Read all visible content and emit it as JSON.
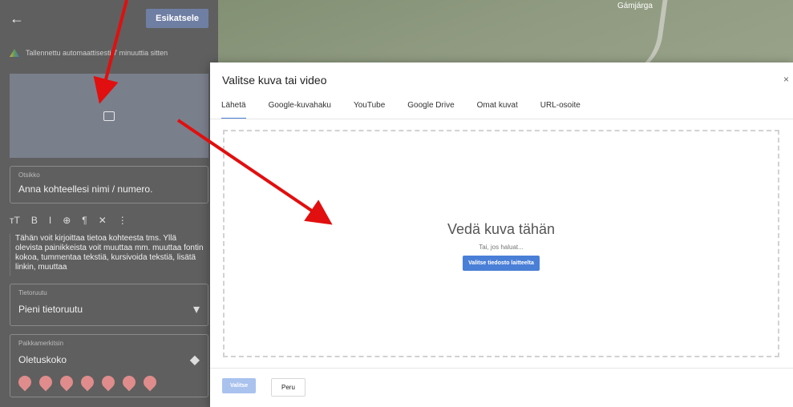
{
  "left_panel": {
    "preview_label": "Esikatsele",
    "saved_text": "Tallennettu automaattisesti 7 minuuttia sitten",
    "title_field_label": "Otsikko",
    "title_field_value": "Anna kohteellesi nimi / numero.",
    "toolbar_items": [
      "тТ",
      "B",
      "I",
      "⊕",
      "¶",
      "✕",
      "⋮"
    ],
    "body_text": "Tähän voit kirjoittaa tietoa kohteesta tms. Yllä olevista painikkeista voit muuttaa mm. muuttaa fontin kokoa, tummentaa tekstiä, kursivoida tekstiä, lisätä linkin, muuttaa",
    "tietoruutu_label": "Tietoruutu",
    "tietoruutu_value": "Pieni tietoruutu",
    "marker_label": "Paikkamerkitsin",
    "marker_value": "Oletuskoko"
  },
  "map": {
    "place_name": "Gámjárga"
  },
  "dialog": {
    "title": "Valitse kuva tai video",
    "close": "×",
    "tabs": [
      "Lähetä",
      "Google-kuvahaku",
      "YouTube",
      "Google Drive",
      "Omat kuvat",
      "URL-osoite"
    ],
    "dropzone_title": "Vedä kuva tähän",
    "dropzone_sub": "Tai, jos haluat...",
    "dropzone_button": "Valitse tiedosto laitteelta",
    "select_button": "Valitse",
    "cancel_button": "Peru"
  },
  "colors": {
    "accent": "#4a7fd7",
    "arrow": "#e10f0f"
  }
}
